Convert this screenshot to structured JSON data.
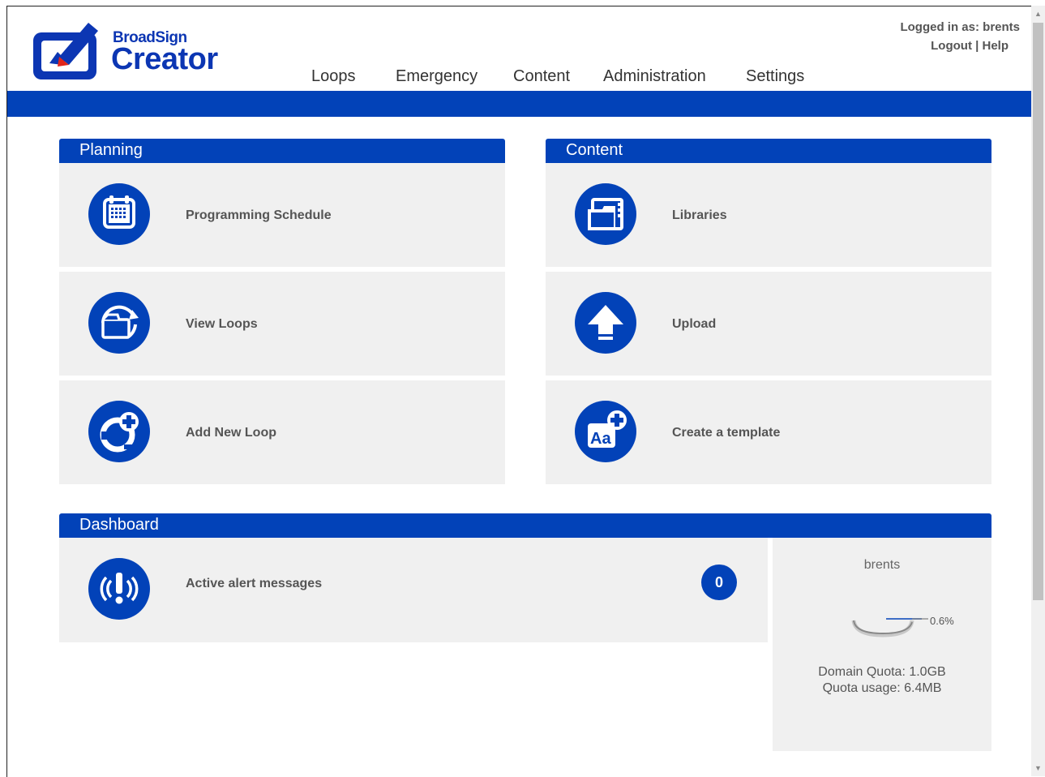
{
  "app": {
    "brand_small": "BroadSign",
    "brand_big": "Creator"
  },
  "nav": {
    "items": [
      {
        "label": "Loops"
      },
      {
        "label": "Emergency"
      },
      {
        "label": "Content"
      },
      {
        "label": "Administration"
      },
      {
        "label": "Settings"
      }
    ]
  },
  "account": {
    "logged_in_as": "Logged in as: brents",
    "logout": "Logout",
    "separator": "|",
    "help": "Help"
  },
  "planning": {
    "title": "Planning",
    "tiles": [
      {
        "label": "Programming Schedule",
        "icon": "calendar-icon"
      },
      {
        "label": "View Loops",
        "icon": "loop-folder-icon"
      },
      {
        "label": "Add New Loop",
        "icon": "add-loop-icon"
      }
    ]
  },
  "content": {
    "title": "Content",
    "tiles": [
      {
        "label": "Libraries",
        "icon": "library-folder-icon"
      },
      {
        "label": "Upload",
        "icon": "upload-arrow-icon"
      },
      {
        "label": "Create a template",
        "icon": "template-add-icon"
      }
    ]
  },
  "dashboard": {
    "title": "Dashboard",
    "alert_label": "Active alert messages",
    "alert_count": "0",
    "quota": {
      "user": "brents",
      "usage_percent_label": "0.6%",
      "usage_percent": 0.6,
      "domain_quota": "Domain Quota: 1.0GB",
      "quota_usage": "Quota usage: 6.4MB"
    }
  },
  "colors": {
    "brand_blue": "#0242b8",
    "tile_bg": "#f0f0f0"
  }
}
